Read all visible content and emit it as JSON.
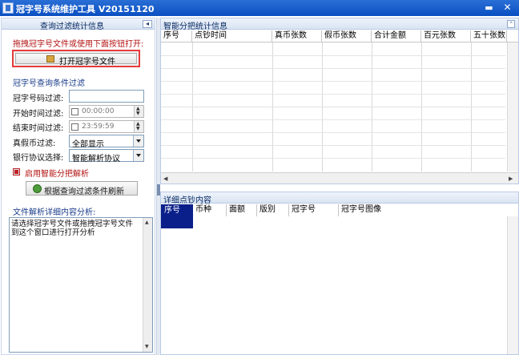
{
  "window": {
    "title": "冠字号系统维护工具 V20151120",
    "minimize_glyph": "▬",
    "close_glyph": "✕"
  },
  "left_panel": {
    "title": "查询过滤统计信息",
    "pin_glyph": "◂",
    "prompt": "拖拽冠字号文件或使用下面按钮打开:",
    "open_button_label": "打开冠字号文件",
    "filter_title": "冠字号查询条件过滤",
    "labels": {
      "code": "冠字号码过滤:",
      "start_time": "开始时间过滤:",
      "end_time": "结束时间过滤:",
      "fake": "真假币过滤:",
      "bank": "银行协议选择:"
    },
    "code_value": "",
    "start_time_value": "00:00:00",
    "end_time_value": "23:59:59",
    "fake_selected": "全部显示",
    "bank_selected": "智能解析协议",
    "smart_checkbox_label": "启用智能分把解析",
    "refresh_button_label": "根据查询过滤条件刷新",
    "analysis_title": "文件解析详细内容分析:",
    "analysis_text": "请选择冠字号文件或拖拽冠字号文件到这个窗口进行打开分析"
  },
  "top_panel": {
    "title": "智能分把统计信息",
    "collapse_glyph": "⌃",
    "columns": [
      "序号",
      "点钞时间",
      "真币张数",
      "假币张数",
      "合计金额",
      "百元张数",
      "五十张数"
    ]
  },
  "bottom_panel": {
    "title": "详细点钞内容",
    "columns": [
      "序号",
      "币种",
      "面额",
      "版别",
      "冠字号",
      "冠字号图像"
    ]
  }
}
